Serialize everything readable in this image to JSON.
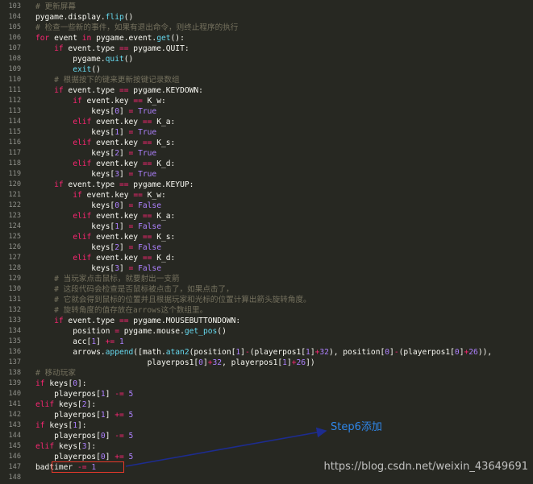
{
  "lines": [
    {
      "n": "103",
      "t": [
        [
          "com",
          "# 更新屏幕"
        ]
      ]
    },
    {
      "n": "104",
      "t": [
        [
          "",
          "pygame.display."
        ],
        [
          "fn",
          "flip"
        ],
        [
          "",
          "()"
        ]
      ]
    },
    {
      "n": "105",
      "t": [
        [
          "com",
          "# 检查一些新的事件，如果有退出命令，则终止程序的执行"
        ]
      ]
    },
    {
      "n": "106",
      "t": [
        [
          "kw",
          "for"
        ],
        [
          "",
          " event "
        ],
        [
          "kw",
          "in"
        ],
        [
          "",
          " pygame.event."
        ],
        [
          "fn",
          "get"
        ],
        [
          "",
          "():"
        ]
      ]
    },
    {
      "n": "107",
      "t": [
        [
          "kw",
          "    if"
        ],
        [
          "",
          " event.type "
        ],
        [
          "op",
          "=="
        ],
        [
          "",
          " pygame.QUIT:"
        ]
      ]
    },
    {
      "n": "108",
      "t": [
        [
          "",
          "        pygame."
        ],
        [
          "fn",
          "quit"
        ],
        [
          "",
          "()"
        ]
      ]
    },
    {
      "n": "109",
      "t": [
        [
          "",
          "        "
        ],
        [
          "fn",
          "exit"
        ],
        [
          "",
          "()"
        ]
      ]
    },
    {
      "n": "110",
      "t": [
        [
          "com",
          "    # 根据按下的键来更新按键记录数组"
        ]
      ]
    },
    {
      "n": "111",
      "t": [
        [
          "kw",
          "    if"
        ],
        [
          "",
          " event.type "
        ],
        [
          "op",
          "=="
        ],
        [
          "",
          " pygame.KEYDOWN:"
        ]
      ]
    },
    {
      "n": "112",
      "t": [
        [
          "kw",
          "        if"
        ],
        [
          "",
          " event.key "
        ],
        [
          "op",
          "=="
        ],
        [
          "",
          " K_w:"
        ]
      ]
    },
    {
      "n": "113",
      "t": [
        [
          "",
          "            keys["
        ],
        [
          "num",
          "0"
        ],
        [
          "",
          "] "
        ],
        [
          "op",
          "="
        ],
        [
          "num",
          " True"
        ]
      ]
    },
    {
      "n": "114",
      "t": [
        [
          "kw",
          "        elif"
        ],
        [
          "",
          " event.key "
        ],
        [
          "op",
          "=="
        ],
        [
          "",
          " K_a:"
        ]
      ]
    },
    {
      "n": "115",
      "t": [
        [
          "",
          "            keys["
        ],
        [
          "num",
          "1"
        ],
        [
          "",
          "] "
        ],
        [
          "op",
          "="
        ],
        [
          "num",
          " True"
        ]
      ]
    },
    {
      "n": "116",
      "t": [
        [
          "kw",
          "        elif"
        ],
        [
          "",
          " event.key "
        ],
        [
          "op",
          "=="
        ],
        [
          "",
          " K_s:"
        ]
      ]
    },
    {
      "n": "117",
      "t": [
        [
          "",
          "            keys["
        ],
        [
          "num",
          "2"
        ],
        [
          "",
          "] "
        ],
        [
          "op",
          "="
        ],
        [
          "num",
          " True"
        ]
      ]
    },
    {
      "n": "118",
      "t": [
        [
          "kw",
          "        elif"
        ],
        [
          "",
          " event.key "
        ],
        [
          "op",
          "=="
        ],
        [
          "",
          " K_d:"
        ]
      ]
    },
    {
      "n": "119",
      "t": [
        [
          "",
          "            keys["
        ],
        [
          "num",
          "3"
        ],
        [
          "",
          "] "
        ],
        [
          "op",
          "="
        ],
        [
          "num",
          " True"
        ]
      ]
    },
    {
      "n": "120",
      "t": [
        [
          "kw",
          "    if"
        ],
        [
          "",
          " event.type "
        ],
        [
          "op",
          "=="
        ],
        [
          "",
          " pygame.KEYUP:"
        ]
      ]
    },
    {
      "n": "121",
      "t": [
        [
          "kw",
          "        if"
        ],
        [
          "",
          " event.key "
        ],
        [
          "op",
          "=="
        ],
        [
          "",
          " K_w:"
        ]
      ]
    },
    {
      "n": "122",
      "t": [
        [
          "",
          "            keys["
        ],
        [
          "num",
          "0"
        ],
        [
          "",
          "] "
        ],
        [
          "op",
          "="
        ],
        [
          "num",
          " False"
        ]
      ]
    },
    {
      "n": "123",
      "t": [
        [
          "kw",
          "        elif"
        ],
        [
          "",
          " event.key "
        ],
        [
          "op",
          "=="
        ],
        [
          "",
          " K_a:"
        ]
      ]
    },
    {
      "n": "124",
      "t": [
        [
          "",
          "            keys["
        ],
        [
          "num",
          "1"
        ],
        [
          "",
          "] "
        ],
        [
          "op",
          "="
        ],
        [
          "num",
          " False"
        ]
      ]
    },
    {
      "n": "125",
      "t": [
        [
          "kw",
          "        elif"
        ],
        [
          "",
          " event.key "
        ],
        [
          "op",
          "=="
        ],
        [
          "",
          " K_s:"
        ]
      ]
    },
    {
      "n": "126",
      "t": [
        [
          "",
          "            keys["
        ],
        [
          "num",
          "2"
        ],
        [
          "",
          "] "
        ],
        [
          "op",
          "="
        ],
        [
          "num",
          " False"
        ]
      ]
    },
    {
      "n": "127",
      "t": [
        [
          "kw",
          "        elif"
        ],
        [
          "",
          " event.key "
        ],
        [
          "op",
          "=="
        ],
        [
          "",
          " K_d:"
        ]
      ]
    },
    {
      "n": "128",
      "t": [
        [
          "",
          "            keys["
        ],
        [
          "num",
          "3"
        ],
        [
          "",
          "] "
        ],
        [
          "op",
          "="
        ],
        [
          "num",
          " False"
        ]
      ]
    },
    {
      "n": "129",
      "t": [
        [
          "com",
          "    # 当玩家点击鼠标，就要射出一支箭"
        ]
      ]
    },
    {
      "n": "130",
      "t": [
        [
          "com",
          "    # 这段代码会检查是否鼠标被点击了，如果点击了，"
        ]
      ]
    },
    {
      "n": "131",
      "t": [
        [
          "com",
          "    # 它就会得到鼠标的位置并且根据玩家和光标的位置计算出箭头旋转角度。"
        ]
      ]
    },
    {
      "n": "132",
      "t": [
        [
          "com",
          "    # 旋转角度的值存放在arrows这个数组里。"
        ]
      ]
    },
    {
      "n": "133",
      "t": [
        [
          "kw",
          "    if"
        ],
        [
          "",
          " event.type "
        ],
        [
          "op",
          "=="
        ],
        [
          "",
          " pygame.MOUSEBUTTONDOWN:"
        ]
      ]
    },
    {
      "n": "134",
      "t": [
        [
          "",
          "        position "
        ],
        [
          "op",
          "="
        ],
        [
          "",
          " pygame.mouse."
        ],
        [
          "fn",
          "get_pos"
        ],
        [
          "",
          "()"
        ]
      ]
    },
    {
      "n": "135",
      "t": [
        [
          "",
          "        acc["
        ],
        [
          "num",
          "1"
        ],
        [
          "",
          "] "
        ],
        [
          "op",
          "+="
        ],
        [
          "num",
          " 1"
        ]
      ]
    },
    {
      "n": "136",
      "t": [
        [
          "",
          "        arrows."
        ],
        [
          "fn",
          "append"
        ],
        [
          "",
          "([math."
        ],
        [
          "fn",
          "atan2"
        ],
        [
          "",
          "(position["
        ],
        [
          "num",
          "1"
        ],
        [
          "",
          "]"
        ],
        [
          "op",
          "-"
        ],
        [
          "",
          "(playerpos1["
        ],
        [
          "num",
          "1"
        ],
        [
          "",
          "]"
        ],
        [
          "op",
          "+"
        ],
        [
          "num",
          "32"
        ],
        [
          "",
          "), position["
        ],
        [
          "num",
          "0"
        ],
        [
          "",
          "]"
        ],
        [
          "op",
          "-"
        ],
        [
          "",
          "(playerpos1["
        ],
        [
          "num",
          "0"
        ],
        [
          "",
          "]"
        ],
        [
          "op",
          "+"
        ],
        [
          "num",
          "26"
        ],
        [
          "",
          ")),"
        ]
      ]
    },
    {
      "n": "137",
      "t": [
        [
          "",
          "                        playerpos1["
        ],
        [
          "num",
          "0"
        ],
        [
          "",
          "]"
        ],
        [
          "op",
          "+"
        ],
        [
          "num",
          "32"
        ],
        [
          "",
          ", playerpos1["
        ],
        [
          "num",
          "1"
        ],
        [
          "",
          "]"
        ],
        [
          "op",
          "+"
        ],
        [
          "num",
          "26"
        ],
        [
          "",
          "])"
        ]
      ]
    },
    {
      "n": "138",
      "t": [
        [
          "com",
          "# 移动玩家"
        ]
      ]
    },
    {
      "n": "139",
      "t": [
        [
          "kw",
          "if"
        ],
        [
          "",
          " keys["
        ],
        [
          "num",
          "0"
        ],
        [
          "",
          "]:"
        ]
      ]
    },
    {
      "n": "140",
      "t": [
        [
          "",
          "    playerpos["
        ],
        [
          "num",
          "1"
        ],
        [
          "",
          "] "
        ],
        [
          "op",
          "-="
        ],
        [
          "num",
          " 5"
        ]
      ]
    },
    {
      "n": "141",
      "t": [
        [
          "kw",
          "elif"
        ],
        [
          "",
          " keys["
        ],
        [
          "num",
          "2"
        ],
        [
          "",
          "]:"
        ]
      ]
    },
    {
      "n": "142",
      "t": [
        [
          "",
          "    playerpos["
        ],
        [
          "num",
          "1"
        ],
        [
          "",
          "] "
        ],
        [
          "op",
          "+="
        ],
        [
          "num",
          " 5"
        ]
      ]
    },
    {
      "n": "143",
      "t": [
        [
          "kw",
          "if"
        ],
        [
          "",
          " keys["
        ],
        [
          "num",
          "1"
        ],
        [
          "",
          "]:"
        ]
      ]
    },
    {
      "n": "144",
      "t": [
        [
          "",
          "    playerpos["
        ],
        [
          "num",
          "0"
        ],
        [
          "",
          "] "
        ],
        [
          "op",
          "-="
        ],
        [
          "num",
          " 5"
        ]
      ]
    },
    {
      "n": "145",
      "t": [
        [
          "kw",
          "elif"
        ],
        [
          "",
          " keys["
        ],
        [
          "num",
          "3"
        ],
        [
          "",
          "]:"
        ]
      ]
    },
    {
      "n": "146",
      "t": [
        [
          "",
          "    playerpos["
        ],
        [
          "num",
          "0"
        ],
        [
          "",
          "] "
        ],
        [
          "op",
          "+="
        ],
        [
          "num",
          " 5"
        ]
      ]
    },
    {
      "n": "147",
      "t": [
        [
          "",
          "badtimer "
        ],
        [
          "op",
          "-="
        ],
        [
          "num",
          " 1"
        ]
      ]
    },
    {
      "n": "148",
      "t": []
    }
  ],
  "annotation": {
    "step_label": "Step6添加",
    "arrow_color": "#1d2c8f",
    "box_color": "#e8392b"
  },
  "watermark": "https://blog.csdn.net/weixin_43649691",
  "colors": {
    "background": "#272822",
    "keyword": "#f92672",
    "function": "#66d9ef",
    "number": "#ae81ff",
    "comment": "#75715e",
    "text": "#f8f8f2"
  }
}
